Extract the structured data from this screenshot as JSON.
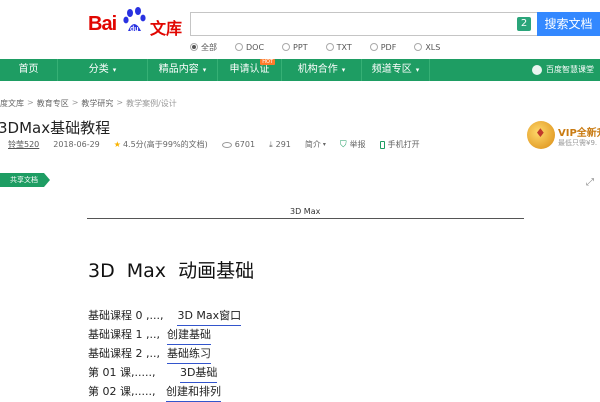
{
  "logo": {
    "bai": "Bai",
    "paw": "du",
    "wenku": "文库"
  },
  "search": {
    "value": "",
    "count": "2",
    "button": "搜索文档"
  },
  "filters": [
    {
      "label": "全部",
      "selected": true
    },
    {
      "label": "DOC",
      "selected": false
    },
    {
      "label": "PPT",
      "selected": false
    },
    {
      "label": "TXT",
      "selected": false
    },
    {
      "label": "PDF",
      "selected": false
    },
    {
      "label": "XLS",
      "selected": false
    }
  ],
  "nav": {
    "items": [
      {
        "label": "首页",
        "arrow": ""
      },
      {
        "label": "分类",
        "arrow": "▾"
      },
      {
        "label": "精品内容",
        "arrow": "▾"
      },
      {
        "label": "申请认证",
        "arrow": "",
        "badge": "HOT"
      },
      {
        "label": "机构合作",
        "arrow": "▾"
      },
      {
        "label": "频道专区",
        "arrow": "▾"
      }
    ],
    "right": "百度智慧课堂"
  },
  "breadcrumb": [
    "度文库",
    "教育专区",
    "教学研究",
    "教学案例/设计"
  ],
  "doc": {
    "title": "3DMax基础教程",
    "uploader": "铃莹520",
    "date": "2018-06-29",
    "rating": "4.5分(高于99%的文档)",
    "views": "6701",
    "downloads": "291",
    "intro": "简介",
    "report": "举报",
    "mobile": "手机打开"
  },
  "vip": {
    "line1": "VIP全新升",
    "line2": "最低只需¥9."
  },
  "share_tag": "共享文档",
  "page": {
    "header": "3D Max",
    "heading": "3D Max  动画基础",
    "toc": [
      {
        "label": "基础课程 0 ,...,    ",
        "link": "3D Max窗口"
      },
      {
        "label": "基础课程 1 ,..,  ",
        "link": "创建基础"
      },
      {
        "label": "基础课程 2 ,..,  ",
        "link": "基础练习"
      },
      {
        "label": "第 01 课,.....,       ",
        "link": "3D基础"
      },
      {
        "label": "第 02 课,.....,   ",
        "link": "创建和排列"
      }
    ]
  }
}
